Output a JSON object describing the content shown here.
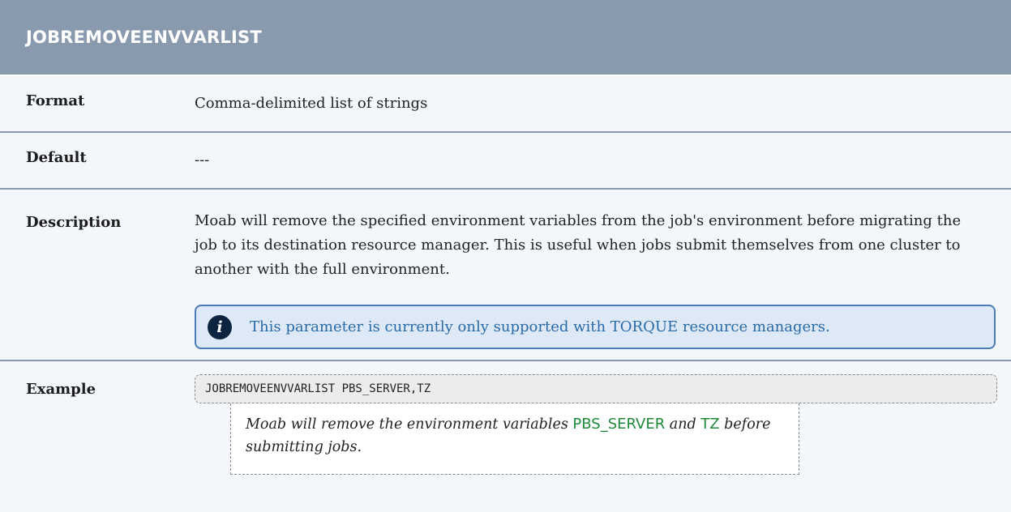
{
  "header": {
    "title": "JOBREMOVEENVVARLIST"
  },
  "rows": {
    "format": {
      "label": "Format",
      "value": "Comma-delimited list of strings"
    },
    "default": {
      "label": "Default",
      "value": "---"
    },
    "description": {
      "label": "Description",
      "text": "Moab will remove the specified environment variables from the job's environment before migrating the job to its destination resource manager. This is useful when jobs submit themselves from one cluster to another with the full environment.",
      "note": {
        "icon": "info-icon",
        "icon_glyph": "i",
        "text": "This parameter is currently only supported with TORQUE resource managers."
      }
    },
    "example": {
      "label": "Example",
      "code": "JOBREMOVEENVVARLIST PBS_SERVER,TZ",
      "explanation": {
        "part1": "Moab will remove the environment variables ",
        "var1": "PBS_SERVER",
        "part2": " and ",
        "var2": "TZ",
        "part3": " before submitting jobs."
      }
    }
  },
  "colors": {
    "header_bg": "#8a9aae",
    "row_bg": "#f3f7fb",
    "note_bg": "#dde9f6",
    "note_border": "#4a7bb5",
    "note_text": "#2b6aa8",
    "keyword": "#1f8a3a"
  }
}
